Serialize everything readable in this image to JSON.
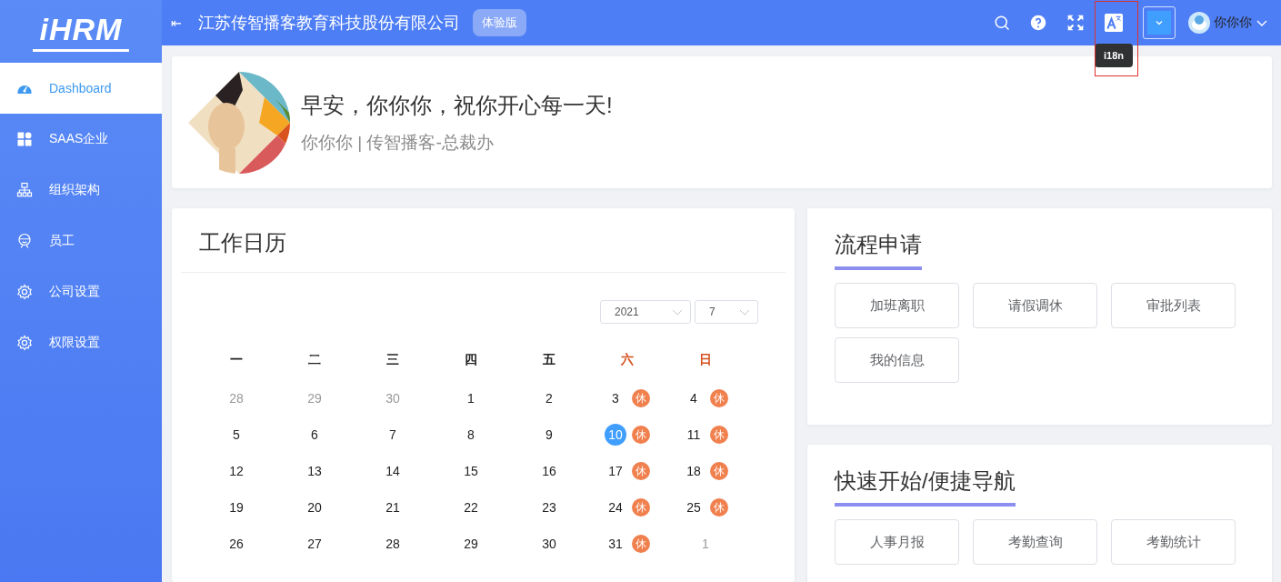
{
  "sidebar": {
    "logo": "iHRM",
    "items": [
      {
        "label": "Dashboard",
        "kind": "dashboard",
        "selected": true
      },
      {
        "label": "SAAS企业",
        "kind": "grid",
        "selected": false
      },
      {
        "label": "组织架构",
        "kind": "org",
        "selected": false
      },
      {
        "label": "员工",
        "kind": "person",
        "selected": false
      },
      {
        "label": "公司设置",
        "kind": "gear",
        "selected": false
      },
      {
        "label": "权限设置",
        "kind": "gear",
        "selected": false
      }
    ]
  },
  "header": {
    "menu_icon": "⇤",
    "company": "江苏传智播客教育科技股份有限公司",
    "badge": "体验版",
    "tooltip": "i18n",
    "user": "你你你"
  },
  "profile": {
    "greeting": "早安，你你你，祝你开心每一天!",
    "subtitle": "你你你 | 传智播客-总裁办"
  },
  "calendar": {
    "title": "工作日历",
    "year": "2021",
    "month": "7",
    "weekdays": [
      {
        "label": "一",
        "weekend": false
      },
      {
        "label": "二",
        "weekend": false
      },
      {
        "label": "三",
        "weekend": false
      },
      {
        "label": "四",
        "weekend": false
      },
      {
        "label": "五",
        "weekend": false
      },
      {
        "label": "六",
        "weekend": true
      },
      {
        "label": "日",
        "weekend": true
      }
    ],
    "weeks": [
      [
        {
          "day": "28",
          "current": false,
          "selected": false
        },
        {
          "day": "29",
          "current": false,
          "selected": false
        },
        {
          "day": "30",
          "current": false,
          "selected": false
        },
        {
          "day": "1",
          "current": true,
          "selected": false
        },
        {
          "day": "2",
          "current": true,
          "selected": false
        },
        {
          "day": "3",
          "current": true,
          "selected": false,
          "rest": "休"
        },
        {
          "day": "4",
          "current": true,
          "selected": false,
          "rest": "休"
        }
      ],
      [
        {
          "day": "5",
          "current": true,
          "selected": false
        },
        {
          "day": "6",
          "current": true,
          "selected": false
        },
        {
          "day": "7",
          "current": true,
          "selected": false
        },
        {
          "day": "8",
          "current": true,
          "selected": false
        },
        {
          "day": "9",
          "current": true,
          "selected": false
        },
        {
          "day": "10",
          "current": true,
          "selected": true,
          "rest": "休"
        },
        {
          "day": "11",
          "current": true,
          "selected": false,
          "rest": "休"
        }
      ],
      [
        {
          "day": "12",
          "current": true,
          "selected": false
        },
        {
          "day": "13",
          "current": true,
          "selected": false
        },
        {
          "day": "14",
          "current": true,
          "selected": false
        },
        {
          "day": "15",
          "current": true,
          "selected": false
        },
        {
          "day": "16",
          "current": true,
          "selected": false
        },
        {
          "day": "17",
          "current": true,
          "selected": false,
          "rest": "休"
        },
        {
          "day": "18",
          "current": true,
          "selected": false,
          "rest": "休"
        }
      ],
      [
        {
          "day": "19",
          "current": true,
          "selected": false
        },
        {
          "day": "20",
          "current": true,
          "selected": false
        },
        {
          "day": "21",
          "current": true,
          "selected": false
        },
        {
          "day": "22",
          "current": true,
          "selected": false
        },
        {
          "day": "23",
          "current": true,
          "selected": false
        },
        {
          "day": "24",
          "current": true,
          "selected": false,
          "rest": "休"
        },
        {
          "day": "25",
          "current": true,
          "selected": false,
          "rest": "休"
        }
      ],
      [
        {
          "day": "26",
          "current": true,
          "selected": false
        },
        {
          "day": "27",
          "current": true,
          "selected": false
        },
        {
          "day": "28",
          "current": true,
          "selected": false
        },
        {
          "day": "29",
          "current": true,
          "selected": false
        },
        {
          "day": "30",
          "current": true,
          "selected": false
        },
        {
          "day": "31",
          "current": true,
          "selected": false,
          "rest": "休"
        },
        {
          "day": "1",
          "current": false,
          "selected": false
        }
      ]
    ]
  },
  "process": {
    "title": "流程申请",
    "buttons": [
      "加班离职",
      "请假调休",
      "审批列表",
      "我的信息"
    ]
  },
  "quick": {
    "title": "快速开始/便捷导航",
    "buttons": [
      "人事月报",
      "考勤查询",
      "考勤统计"
    ]
  }
}
